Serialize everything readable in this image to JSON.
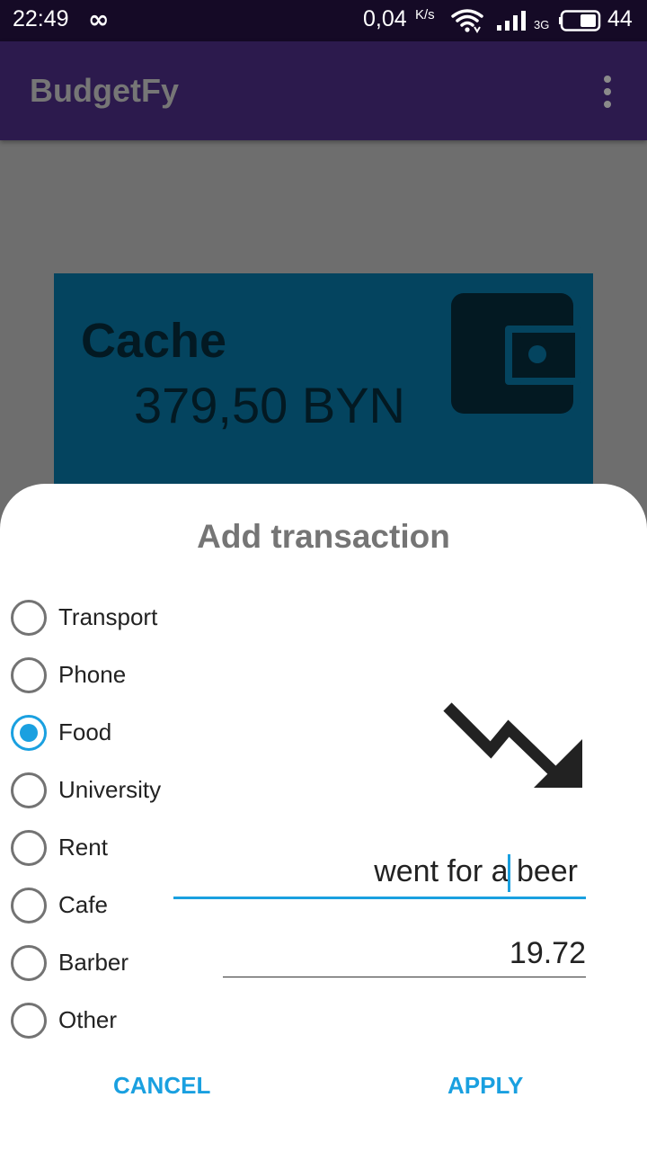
{
  "status_bar": {
    "time": "22:49",
    "loop_glyph": "∞",
    "net_speed": "0,04",
    "net_speed_unit": "K/s",
    "network_type": "3G",
    "battery_level": "44"
  },
  "app_bar": {
    "title": "BudgetFy",
    "menu_icon": "more-vert-icon"
  },
  "account": {
    "name": "Cache",
    "balance": "379,50 BYN",
    "icon": "wallet-icon"
  },
  "dialog": {
    "title": "Add transaction",
    "categories": [
      {
        "label": "Transport",
        "checked": false
      },
      {
        "label": "Phone",
        "checked": false
      },
      {
        "label": "Food",
        "checked": true
      },
      {
        "label": "University",
        "checked": false
      },
      {
        "label": "Rent",
        "checked": false
      },
      {
        "label": "Cafe",
        "checked": false
      },
      {
        "label": "Barber",
        "checked": false
      },
      {
        "label": "Other",
        "checked": false
      }
    ],
    "trend_icon": "trending-down-icon",
    "description_value": "went for a beer",
    "amount_value": "19.72",
    "cancel_label": "CANCEL",
    "apply_label": "APPLY"
  },
  "colors": {
    "accent": "#1aa0e0",
    "status_bar": "#150a26",
    "app_bar": "#2c1a4d",
    "card": "#04445f",
    "scrim": "#6e6e6e"
  }
}
